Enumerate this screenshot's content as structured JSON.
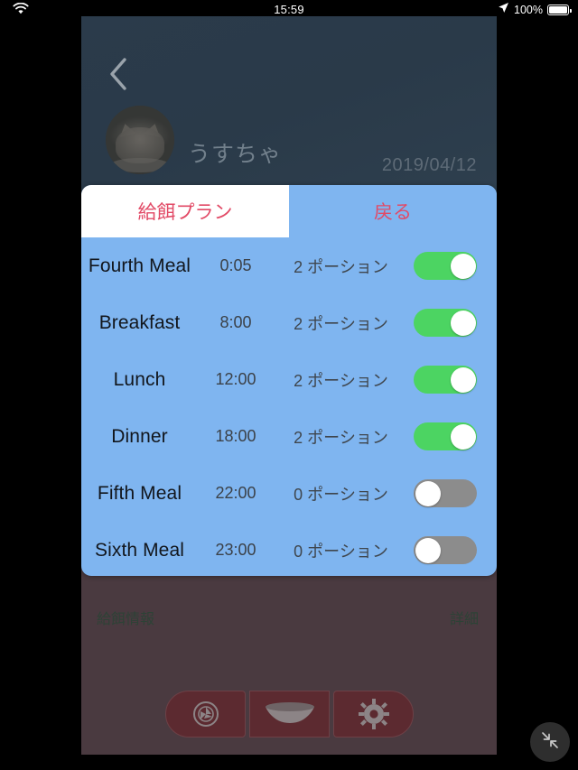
{
  "status_bar": {
    "wifi_icon": "wifi-icon",
    "time": "15:59",
    "location_icon": "location-arrow-icon",
    "battery_percent": "100%",
    "battery_icon": "battery-full-icon"
  },
  "app": {
    "back_icon": "chevron-left-icon",
    "avatar_icon": "cat-avatar",
    "pet_name": "うすちゃ",
    "date": "2019/04/12",
    "info_label": "給餌情報",
    "detail_label": "詳細",
    "toolbar": [
      {
        "name": "camera-button",
        "icon": "camera-aperture-icon"
      },
      {
        "name": "feed-bowl-button",
        "icon": "food-bowl-icon"
      },
      {
        "name": "settings-button",
        "icon": "gear-icon"
      }
    ],
    "minimize_icon": "minimize-arrows-icon"
  },
  "modal": {
    "tabs": [
      {
        "label": "給餌プラン",
        "active": true
      },
      {
        "label": "戻る",
        "active": false
      }
    ],
    "meals": [
      {
        "name": "Fourth Meal",
        "time": "0:05",
        "portion": "2 ポーション",
        "enabled": true
      },
      {
        "name": "Breakfast",
        "time": "8:00",
        "portion": "2 ポーション",
        "enabled": true
      },
      {
        "name": "Lunch",
        "time": "12:00",
        "portion": "2 ポーション",
        "enabled": true
      },
      {
        "name": "Dinner",
        "time": "18:00",
        "portion": "2 ポーション",
        "enabled": true
      },
      {
        "name": "Fifth Meal",
        "time": "22:00",
        "portion": "0 ポーション",
        "enabled": false
      },
      {
        "name": "Sixth Meal",
        "time": "23:00",
        "portion": "0 ポーション",
        "enabled": false
      }
    ]
  },
  "colors": {
    "modal_blue": "#7fb5f0",
    "tab_text_pink": "#e24a66",
    "toggle_on_green": "#4cd462",
    "toggle_off_gray": "#8c8c8c",
    "app_background": "#4a3a40",
    "header_navy": "#2b3b4b",
    "tool_button_red": "#5c2a30"
  }
}
